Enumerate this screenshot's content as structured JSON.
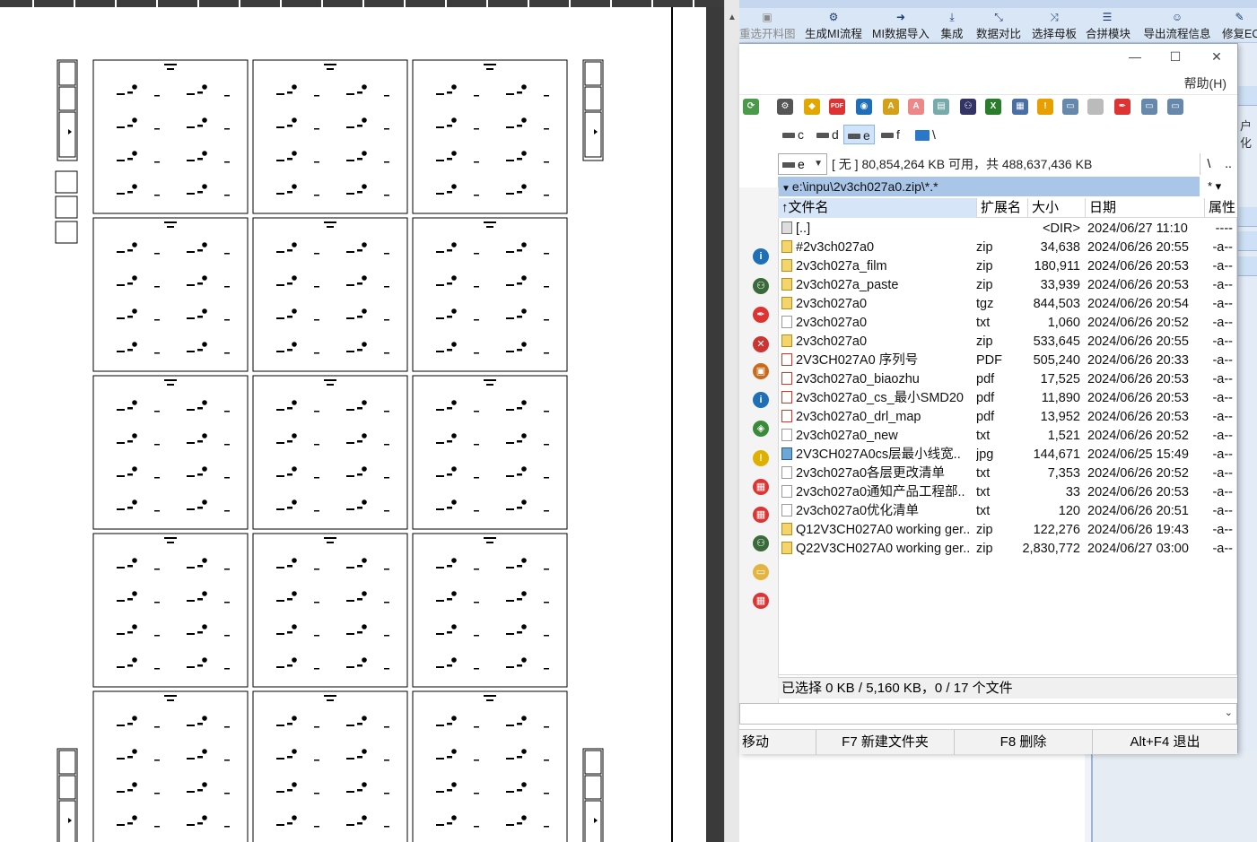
{
  "host_toolbar": {
    "buttons": [
      {
        "label": "重选开料图",
        "icon": "image-icon",
        "disabled": true
      },
      {
        "label": "生成MI流程",
        "icon": "gears-icon",
        "disabled": false
      },
      {
        "label": "MI数据导入",
        "icon": "import-icon",
        "disabled": false
      },
      {
        "label": "集成",
        "icon": "download-icon",
        "disabled": false
      },
      {
        "label": "数据对比",
        "icon": "compare-icon",
        "disabled": false
      },
      {
        "label": "选择母板",
        "icon": "shuffle-icon",
        "disabled": false
      },
      {
        "label": "合拼模块",
        "icon": "list-icon",
        "disabled": false
      },
      {
        "label": "导出流程信息",
        "icon": "smile-icon",
        "disabled": false
      },
      {
        "label": "修复EC",
        "icon": "repair-icon",
        "disabled": false
      }
    ],
    "right_cut_label": "户化"
  },
  "tc": {
    "window_controls": {
      "minimize": "—",
      "maximize": "☐",
      "close": "✕"
    },
    "menu_help": "帮助(H)",
    "drives": [
      {
        "letter": "c",
        "selected": false
      },
      {
        "letter": "d",
        "selected": false
      },
      {
        "letter": "e",
        "selected": true
      },
      {
        "letter": "f",
        "selected": false
      },
      {
        "letter": "\\",
        "selected": false
      }
    ],
    "drive_select_value": "e",
    "space_info": "[ 无 ]  80,854,264 KB 可用，共 488,637,436 KB",
    "root_button": "\\",
    "up_button": "..",
    "path": "e:\\inpu\\2v3ch027a0.zip\\*.*",
    "filter": "* ▾",
    "columns": {
      "name": "文件名",
      "ext": "扩展名",
      "size": "大小",
      "date": "日期",
      "attr": "属性"
    },
    "files": [
      {
        "name": "[..]",
        "ext": "",
        "size": "<DIR>",
        "date": "2024/06/27 11:10",
        "attr": "----",
        "type": "up"
      },
      {
        "name": "#2v3ch027a0",
        "ext": "zip",
        "size": "34,638",
        "date": "2024/06/26 20:55",
        "attr": "-a--",
        "type": "zip"
      },
      {
        "name": "2v3ch027a_film",
        "ext": "zip",
        "size": "180,911",
        "date": "2024/06/26 20:53",
        "attr": "-a--",
        "type": "zip"
      },
      {
        "name": "2v3ch027a_paste",
        "ext": "zip",
        "size": "33,939",
        "date": "2024/06/26 20:53",
        "attr": "-a--",
        "type": "zip"
      },
      {
        "name": "2v3ch027a0",
        "ext": "tgz",
        "size": "844,503",
        "date": "2024/06/26 20:54",
        "attr": "-a--",
        "type": "zip"
      },
      {
        "name": "2v3ch027a0",
        "ext": "txt",
        "size": "1,060",
        "date": "2024/06/26 20:52",
        "attr": "-a--",
        "type": "txt"
      },
      {
        "name": "2v3ch027a0",
        "ext": "zip",
        "size": "533,645",
        "date": "2024/06/26 20:55",
        "attr": "-a--",
        "type": "zip"
      },
      {
        "name": "2V3CH027A0 序列号",
        "ext": "PDF",
        "size": "505,240",
        "date": "2024/06/26 20:33",
        "attr": "-a--",
        "type": "pdf"
      },
      {
        "name": "2v3ch027a0_biaozhu",
        "ext": "pdf",
        "size": "17,525",
        "date": "2024/06/26 20:53",
        "attr": "-a--",
        "type": "pdf"
      },
      {
        "name": "2v3ch027a0_cs_最小SMD20",
        "ext": "pdf",
        "size": "11,890",
        "date": "2024/06/26 20:53",
        "attr": "-a--",
        "type": "pdf"
      },
      {
        "name": "2v3ch027a0_drl_map",
        "ext": "pdf",
        "size": "13,952",
        "date": "2024/06/26 20:53",
        "attr": "-a--",
        "type": "pdf"
      },
      {
        "name": "2v3ch027a0_new",
        "ext": "txt",
        "size": "1,521",
        "date": "2024/06/26 20:52",
        "attr": "-a--",
        "type": "txt"
      },
      {
        "name": "2V3CH027A0cs层最小线宽..",
        "ext": "jpg",
        "size": "144,671",
        "date": "2024/06/25 15:49",
        "attr": "-a--",
        "type": "jpg"
      },
      {
        "name": "2v3ch027a0各层更改清单",
        "ext": "txt",
        "size": "7,353",
        "date": "2024/06/26 20:52",
        "attr": "-a--",
        "type": "txt"
      },
      {
        "name": "2v3ch027a0通知产品工程部..",
        "ext": "txt",
        "size": "33",
        "date": "2024/06/26 20:53",
        "attr": "-a--",
        "type": "txt"
      },
      {
        "name": "2v3ch027a0优化清单",
        "ext": "txt",
        "size": "120",
        "date": "2024/06/26 20:51",
        "attr": "-a--",
        "type": "txt"
      },
      {
        "name": "Q12V3CH027A0 working ger..",
        "ext": "zip",
        "size": "122,276",
        "date": "2024/06/26 19:43",
        "attr": "-a--",
        "type": "zip"
      },
      {
        "name": "Q22V3CH027A0 working ger..",
        "ext": "zip",
        "size": "2,830,772",
        "date": "2024/06/27 03:00",
        "attr": "-a--",
        "type": "zip"
      }
    ],
    "status": "已选择 0 KB / 5,160 KB，0 / 17 个文件",
    "fkeys": [
      "移动",
      "F7 新建文件夹",
      "F8 删除",
      "Alt+F4 退出"
    ]
  },
  "preview": {
    "panel_grid": {
      "columns": 3,
      "rows": 5
    }
  }
}
